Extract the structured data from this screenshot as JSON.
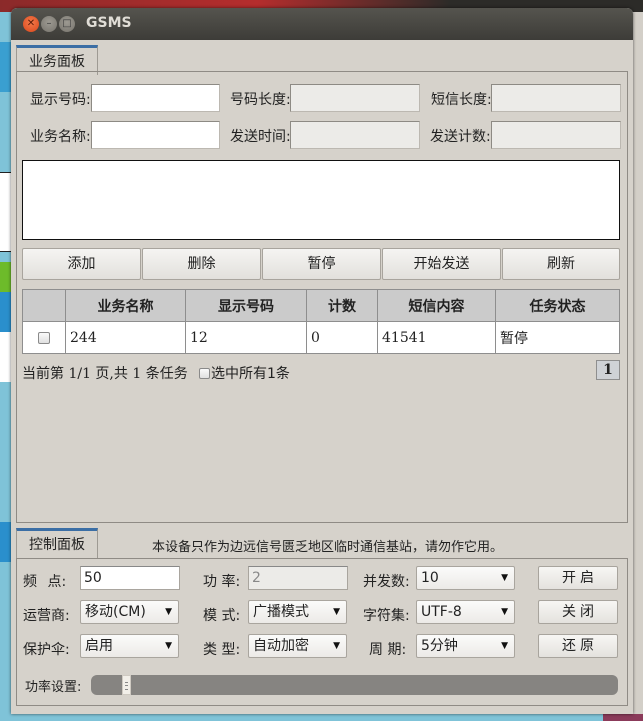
{
  "window": {
    "title": "GSMS"
  },
  "business_panel": {
    "tab_label": "业务面板",
    "fields": {
      "display_number": {
        "label": "显示号码:",
        "value": ""
      },
      "number_length": {
        "label": "号码长度:",
        "value": ""
      },
      "sms_length": {
        "label": "短信长度:",
        "value": ""
      },
      "business_name": {
        "label": "业务名称:",
        "value": ""
      },
      "send_time": {
        "label": "发送时间:",
        "value": ""
      },
      "send_count": {
        "label": "发送计数:",
        "value": ""
      }
    },
    "message_text": "",
    "buttons": {
      "add": "添加",
      "delete": "删除",
      "pause": "暂停",
      "start_send": "开始发送",
      "refresh": "刷新"
    },
    "table": {
      "columns": [
        "",
        "业务名称",
        "显示号码",
        "计数",
        "短信内容",
        "任务状态"
      ],
      "rows": [
        {
          "checked": false,
          "name": "244",
          "number": "12",
          "count": "0",
          "content": "41541",
          "status": "暂停"
        }
      ]
    },
    "pager": {
      "info": "当前第 1/1 页,共 1 条任务",
      "select_all_label": "选中所有1条",
      "current_page": "1"
    }
  },
  "control_panel": {
    "tab_label": "控制面板",
    "notice": "本设备只作为边远信号匮乏地区临时通信基站，请勿作它用。",
    "frequency": {
      "label": "频  点:",
      "value": "50"
    },
    "power": {
      "label": "功  率:",
      "value": "2"
    },
    "concurrency": {
      "label": "并发数:",
      "value": "10"
    },
    "operator": {
      "label": "运营商:",
      "value": "移动(CM)"
    },
    "mode": {
      "label": "模  式:",
      "value": "广播模式"
    },
    "charset": {
      "label": "字符集:",
      "value": "UTF-8"
    },
    "protection": {
      "label": "保护伞:",
      "value": "启用"
    },
    "type": {
      "label": "类  型:",
      "value": "自动加密"
    },
    "period": {
      "label": "周  期:",
      "value": "5分钟"
    },
    "buttons": {
      "open": "开启",
      "close": "关闭",
      "reset": "还原"
    },
    "power_setting": {
      "label": "功率设置:",
      "position_fraction": 0.06
    }
  }
}
